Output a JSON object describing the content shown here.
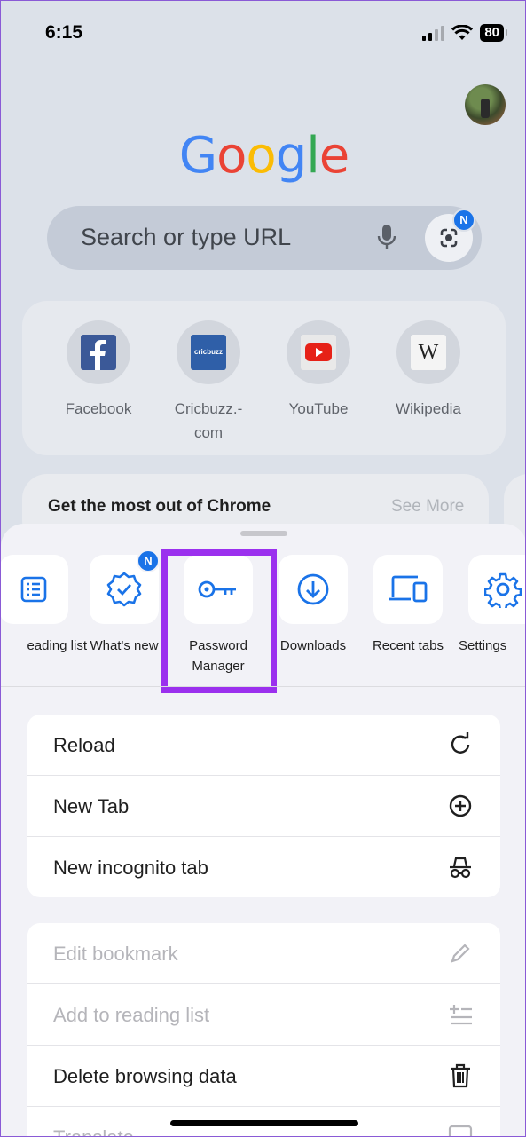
{
  "status": {
    "time": "6:15",
    "battery": "80"
  },
  "google_logo": {
    "letters": [
      "G",
      "o",
      "o",
      "g",
      "l",
      "e"
    ],
    "colors": [
      "#4285f4",
      "#ea4335",
      "#fbbc05",
      "#4285f4",
      "#34a853",
      "#ea4335"
    ]
  },
  "search": {
    "placeholder": "Search or type URL",
    "badge": "N"
  },
  "shortcuts": [
    {
      "label": "Facebook",
      "icon": "facebook-icon"
    },
    {
      "label": "Cricbuzz.-\ncom",
      "icon": "cricbuzz-icon",
      "icon_text": "cricbuzz"
    },
    {
      "label": "YouTube",
      "icon": "youtube-icon"
    },
    {
      "label": "Wikipedia",
      "icon": "wikipedia-icon",
      "icon_text": "W"
    }
  ],
  "promo": {
    "title": "Get the most out of Chrome",
    "link": "See More"
  },
  "menu_tiles": [
    {
      "label": "eading list",
      "icon": "reading-list-icon"
    },
    {
      "label": "What's new",
      "icon": "whats-new-icon",
      "badge": "N"
    },
    {
      "label": "Password\nManager",
      "icon": "key-icon"
    },
    {
      "label": "Downloads",
      "icon": "download-icon"
    },
    {
      "label": "Recent tabs",
      "icon": "devices-icon"
    },
    {
      "label": "Settings",
      "icon": "gear-icon"
    }
  ],
  "menu_group1": [
    {
      "label": "Reload",
      "icon": "reload-icon",
      "disabled": false
    },
    {
      "label": "New Tab",
      "icon": "plus-circle-icon",
      "disabled": false
    },
    {
      "label": "New incognito tab",
      "icon": "incognito-icon",
      "disabled": false
    }
  ],
  "menu_group2": [
    {
      "label": "Edit bookmark",
      "icon": "pencil-icon",
      "disabled": true
    },
    {
      "label": "Add to reading list",
      "icon": "add-reading-list-icon",
      "disabled": true
    },
    {
      "label": "Delete browsing data",
      "icon": "trash-icon",
      "disabled": false
    },
    {
      "label": "Translate",
      "icon": "translate-icon",
      "disabled": true
    }
  ],
  "colors": {
    "accent": "#1a73e8",
    "highlight": "#9b30ee"
  }
}
